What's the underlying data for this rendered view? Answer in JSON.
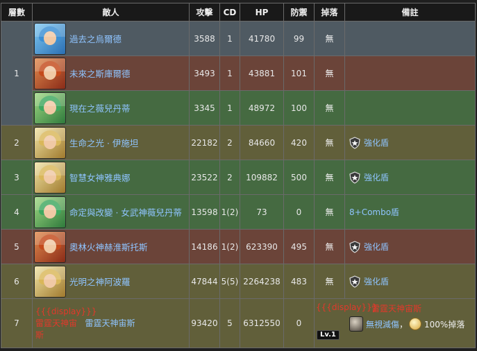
{
  "headers": {
    "floor": "層數",
    "enemy": "敵人",
    "attack": "攻擊",
    "cd": "CD",
    "hp": "HP",
    "defense": "防禦",
    "drop": "掉落",
    "notes": "備註"
  },
  "rows": [
    {
      "floor": "1",
      "name": "過去之烏爾德",
      "attack": "3588",
      "cd": "1",
      "hp": "41780",
      "defense": "99",
      "drop": "無",
      "note": ""
    },
    {
      "floor": "",
      "name": "未來之斯庫爾德",
      "attack": "3493",
      "cd": "1",
      "hp": "43881",
      "defense": "101",
      "drop": "無",
      "note": ""
    },
    {
      "floor": "",
      "name": "現在之薇兒丹蒂",
      "attack": "3345",
      "cd": "1",
      "hp": "48972",
      "defense": "100",
      "drop": "無",
      "note": ""
    },
    {
      "floor": "2",
      "name": "生命之光 · 伊施坦",
      "attack": "22182",
      "cd": "2",
      "hp": "84660",
      "defense": "420",
      "drop": "無",
      "note": "強化盾"
    },
    {
      "floor": "3",
      "name": "智慧女神雅典娜",
      "attack": "23522",
      "cd": "2",
      "hp": "109882",
      "defense": "500",
      "drop": "無",
      "note": "強化盾"
    },
    {
      "floor": "4",
      "name": "命定與改變 · 女武神薇兒丹蒂",
      "attack": "13598",
      "cd": "1(2)",
      "hp": "73",
      "defense": "0",
      "drop": "無",
      "note": "8+Combo盾"
    },
    {
      "floor": "5",
      "name": "奧林火神赫淮斯托斯",
      "attack": "14186",
      "cd": "1(2)",
      "hp": "623390",
      "defense": "495",
      "drop": "無",
      "note": "強化盾"
    },
    {
      "floor": "6",
      "name": "光明之神阿波羅",
      "attack": "47844",
      "cd": "5(5)",
      "hp": "2264238",
      "defense": "483",
      "drop": "無",
      "note": "強化盾"
    },
    {
      "floor": "7",
      "attack": "93420",
      "cd": "5",
      "hp": "6312550",
      "defense": "0"
    }
  ],
  "boss": {
    "template_label": "{{{display}}}",
    "name_red_1": "雷霆天神宙",
    "name_blue": "雷霆天神宙斯",
    "name_red_2": "斯",
    "note_template": "{{{display}}}",
    "note_red_name": "雷霆天神宙斯",
    "note_ignore": "無視減傷",
    "note_sep": "，",
    "note_drop": "100%掉落",
    "level_badge": "Lv.1"
  },
  "colors": {
    "header_bg": "#191919",
    "row_grey": "#4f5a62",
    "row_red": "#6b4439",
    "row_green": "#456a41",
    "row_olive": "#615f3a",
    "link_blue": "#8fc4ff",
    "red_text": "#e0392b"
  }
}
